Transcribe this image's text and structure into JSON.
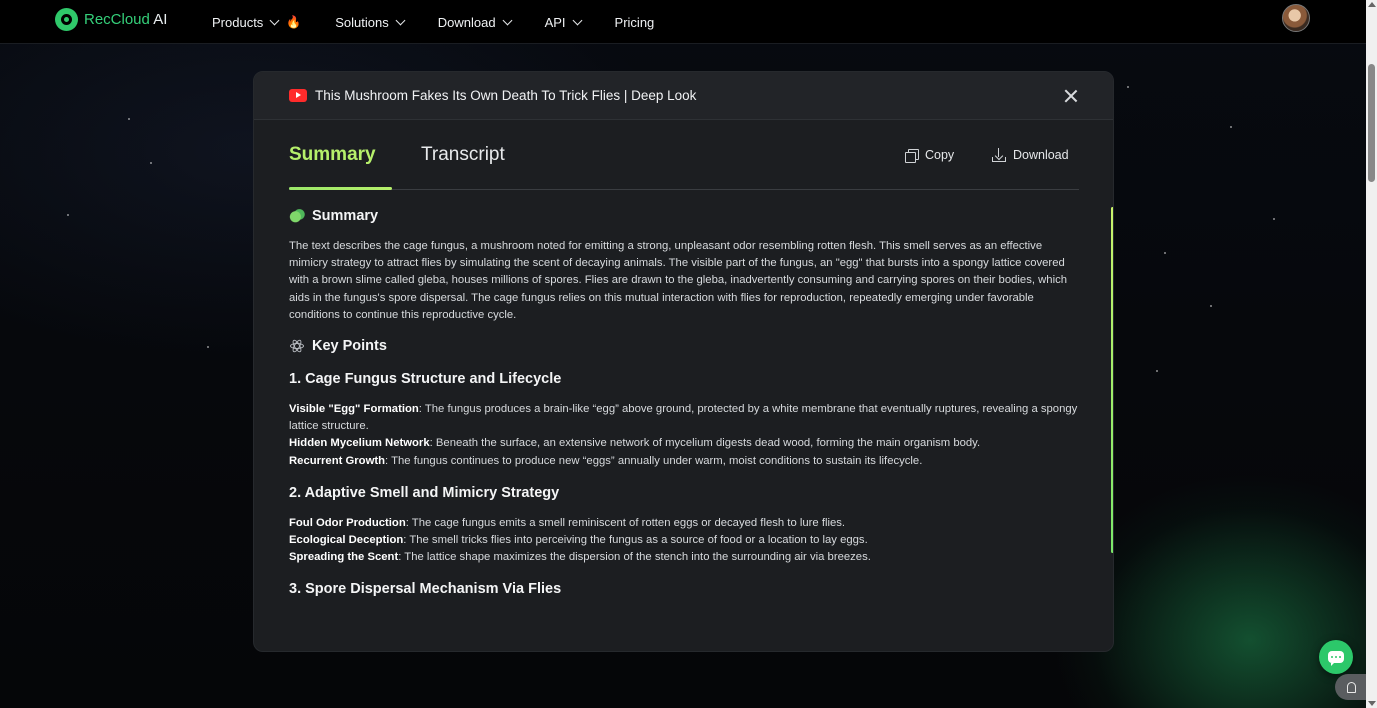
{
  "nav": {
    "brand": "RecCloud",
    "brand_suffix": " AI",
    "items": [
      {
        "label": "Products"
      },
      {
        "label": "Solutions"
      },
      {
        "label": "Download"
      },
      {
        "label": "API"
      },
      {
        "label": "Pricing"
      }
    ]
  },
  "modal": {
    "video_title": "This Mushroom Fakes Its Own Death To Trick Flies | Deep Look",
    "tabs": {
      "summary": "Summary",
      "transcript": "Transcript"
    },
    "actions": {
      "copy": "Copy",
      "download": "Download"
    },
    "summary_heading": "Summary",
    "summary_text": "The text describes the cage fungus, a mushroom noted for emitting a strong, unpleasant odor resembling rotten flesh. This smell serves as an effective mimicry strategy to attract flies by simulating the scent of decaying animals. The visible part of the fungus, an \"egg\" that bursts into a spongy lattice covered with a brown slime called gleba, houses millions of spores. Flies are drawn to the gleba, inadvertently consuming and carrying spores on their bodies, which aids in the fungus's spore dispersal. The cage fungus relies on this mutual interaction with flies for reproduction, repeatedly emerging under favorable conditions to continue this reproductive cycle.",
    "keypoints_heading": "Key Points",
    "points": [
      {
        "title": "1. Cage Fungus Structure and Lifecycle",
        "bullets": [
          {
            "term": "Visible \"Egg\" Formation",
            "text": ": The fungus produces a brain-like “egg” above ground, protected by a white membrane that eventually ruptures, revealing a spongy lattice structure."
          },
          {
            "term": "Hidden Mycelium Network",
            "text": ": Beneath the surface, an extensive network of mycelium digests dead wood, forming the main organism body."
          },
          {
            "term": "Recurrent Growth",
            "text": ": The fungus continues to produce new “eggs” annually under warm, moist conditions to sustain its lifecycle."
          }
        ]
      },
      {
        "title": "2. Adaptive Smell and Mimicry Strategy",
        "bullets": [
          {
            "term": "Foul Odor Production",
            "text": ": The cage fungus emits a smell reminiscent of rotten eggs or decayed flesh to lure flies."
          },
          {
            "term": "Ecological Deception",
            "text": ": The smell tricks flies into perceiving the fungus as a source of food or a location to lay eggs."
          },
          {
            "term": "Spreading the Scent",
            "text": ": The lattice shape maximizes the dispersion of the stench into the surrounding air via breezes."
          }
        ]
      },
      {
        "title": "3. Spore Dispersal Mechanism Via Flies",
        "bullets": []
      }
    ]
  },
  "colors": {
    "accent": "#b6f06b",
    "brand": "#2fc86a"
  }
}
